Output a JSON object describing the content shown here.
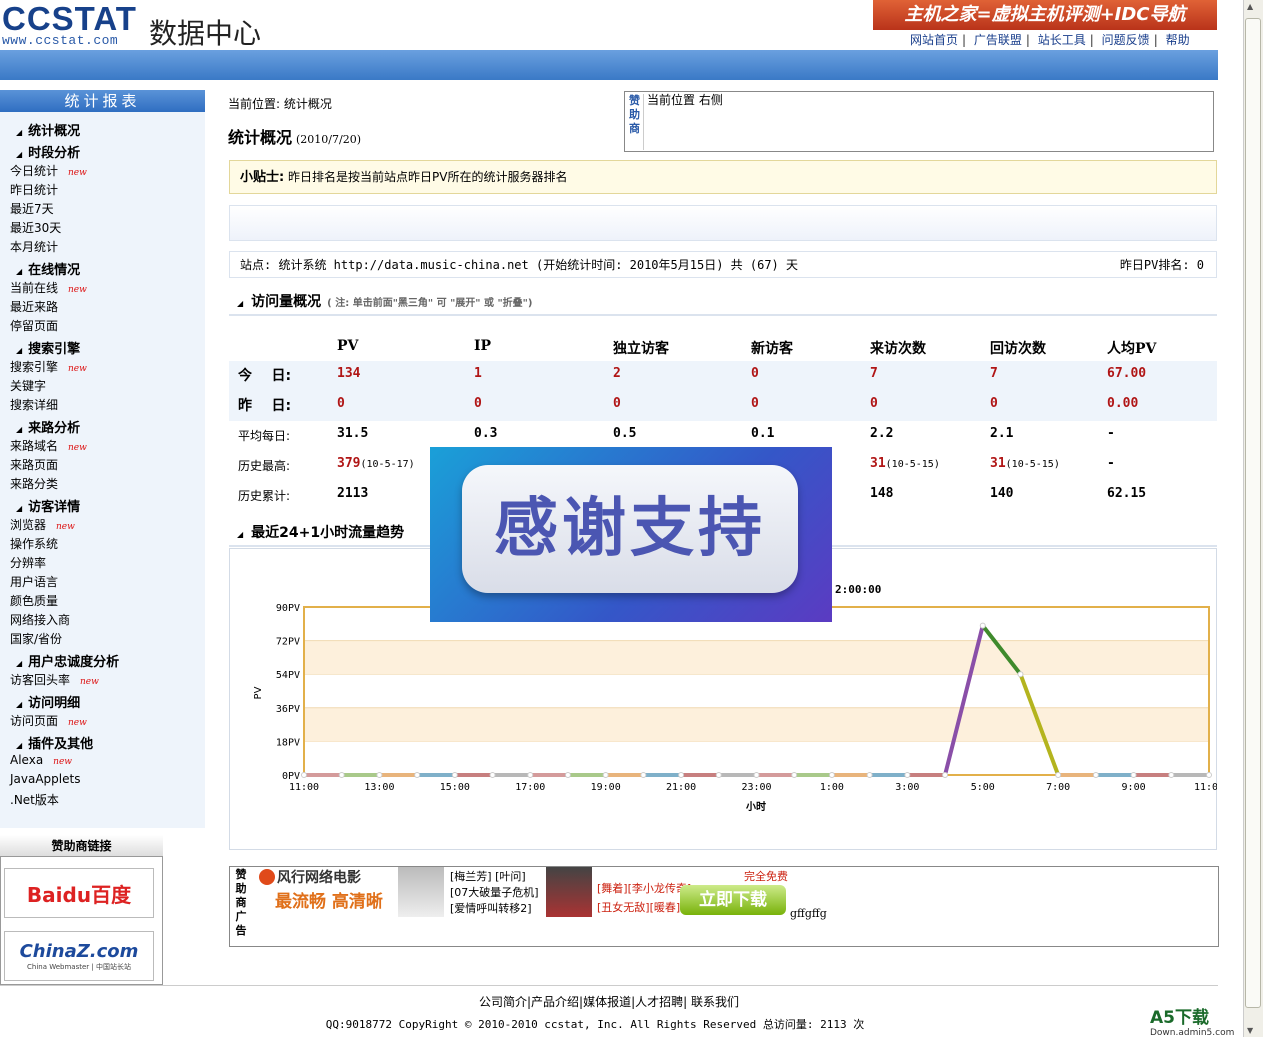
{
  "header": {
    "logo_main": "CCSTAT",
    "logo_url": "www.ccstat.com",
    "subtitle": "数据中心",
    "banner": "主机之家=虚拟主机评测+IDC导航",
    "links": [
      "网站首页",
      "广告联盟",
      "站长工具",
      "问题反馈",
      "帮助"
    ]
  },
  "nav": {
    "title": "统计报表",
    "new_tag": "new",
    "groups": [
      {
        "head": "统计概况",
        "items": []
      },
      {
        "head": "时段分析",
        "items": [
          {
            "label": "今日统计",
            "new": true
          },
          {
            "label": "昨日统计"
          },
          {
            "label": "最近7天"
          },
          {
            "label": "最近30天"
          },
          {
            "label": "本月统计"
          }
        ]
      },
      {
        "head": "在线情况",
        "items": [
          {
            "label": "当前在线",
            "new": true
          },
          {
            "label": "最近来路"
          },
          {
            "label": "停留页面"
          }
        ]
      },
      {
        "head": "搜索引擎",
        "items": [
          {
            "label": "搜索引擎",
            "new": true
          },
          {
            "label": "关键字"
          },
          {
            "label": "搜索详细"
          }
        ]
      },
      {
        "head": "来路分析",
        "items": [
          {
            "label": "来路域名",
            "new": true
          },
          {
            "label": "来路页面"
          },
          {
            "label": "来路分类"
          }
        ]
      },
      {
        "head": "访客详情",
        "items": [
          {
            "label": "浏览器",
            "new": true
          },
          {
            "label": "操作系统"
          },
          {
            "label": "分辨率"
          },
          {
            "label": "用户语言"
          },
          {
            "label": "颜色质量"
          },
          {
            "label": "网络接入商"
          },
          {
            "label": "国家/省份"
          }
        ]
      },
      {
        "head": "用户忠诚度分析",
        "items": [
          {
            "label": "访客回头率",
            "new": true
          }
        ]
      },
      {
        "head": "访问明细",
        "items": [
          {
            "label": "访问页面",
            "new": true
          }
        ]
      },
      {
        "head": "插件及其他",
        "items": [
          {
            "label": "Alexa",
            "new": true
          },
          {
            "label": "JavaApplets"
          },
          {
            "label": ".Net版本"
          }
        ]
      }
    ]
  },
  "sponsor_links": {
    "title": "赞助商链接",
    "logos": [
      "Baidu百度",
      "ChinaZ.com"
    ],
    "chinaz_tagline": "China Webmaster | 中国站长站"
  },
  "main": {
    "breadcrumb": "当前位置: 统计概况",
    "title": "统计概况",
    "date": "(2010/7/20)",
    "ad_tag": "赞助商",
    "ad_text": "当前位置 右侧",
    "tip_label": "小贴士:",
    "tip_text": "昨日排名是按当前站点昨日PV所在的统计服务器排名",
    "site_line": "站点: 统计系统  http://data.music-china.net (开始统计时间: 2010年5月15日) 共 (67) 天",
    "rank": "昨日PV排名: 0"
  },
  "overview": {
    "title": "访问量概况",
    "note": "( 注: 单击前面\"黑三角\" 可 \"展开\" 或 \"折叠\")",
    "columns": [
      "PV",
      "IP",
      "独立访客",
      "新访客",
      "来访次数",
      "回访次数",
      "人均PV"
    ],
    "rows": [
      {
        "label": "今    日:",
        "values": [
          "134",
          "1",
          "2",
          "0",
          "7",
          "7",
          "67.00"
        ]
      },
      {
        "label": "昨    日:",
        "values": [
          "0",
          "0",
          "0",
          "0",
          "0",
          "0",
          "0.00"
        ]
      },
      {
        "label": "平均每日:",
        "values": [
          "31.5",
          "0.3",
          "0.5",
          "0.1",
          "2.2",
          "2.1",
          "-"
        ]
      },
      {
        "label": "历史最高:",
        "values": [
          "379",
          "",
          "",
          "",
          "31",
          "31",
          "-"
        ],
        "dates": [
          "(10-5-17)",
          "",
          "",
          "",
          "(10-5-15)",
          "(10-5-15)",
          ""
        ]
      },
      {
        "label": "历史累计:",
        "values": [
          "2113",
          "",
          "",
          "",
          "148",
          "140",
          "62.15"
        ]
      }
    ]
  },
  "trend": {
    "title": "最近24+1小时流量趋势",
    "tooltip_time": "2:00:00"
  },
  "chart_data": {
    "type": "line",
    "title": "",
    "xlabel": "小时",
    "ylabel": "PV",
    "ylim": [
      0,
      90
    ],
    "yticks": [
      "0PV",
      "18PV",
      "36PV",
      "54PV",
      "72PV",
      "90PV"
    ],
    "xticks": [
      "11:00",
      "13:00",
      "15:00",
      "17:00",
      "19:00",
      "21:00",
      "23:00",
      "1:00",
      "3:00",
      "5:00",
      "7:00",
      "9:00",
      "11:00"
    ],
    "x": [
      "11:00",
      "12:00",
      "13:00",
      "14:00",
      "15:00",
      "16:00",
      "17:00",
      "18:00",
      "19:00",
      "20:00",
      "21:00",
      "22:00",
      "23:00",
      "0:00",
      "1:00",
      "2:00",
      "3:00",
      "4:00",
      "5:00",
      "6:00",
      "7:00",
      "8:00",
      "9:00",
      "10:00",
      "11:00"
    ],
    "values": [
      0,
      0,
      0,
      0,
      0,
      0,
      0,
      0,
      0,
      0,
      0,
      0,
      0,
      0,
      0,
      0,
      0,
      0,
      80,
      54,
      0,
      0,
      0,
      0,
      0
    ],
    "grid": true,
    "colors": {
      "up": "#8a4fa8",
      "down1": "#3f8a2c",
      "down2": "#b4b41e",
      "frame": "#e2b04a",
      "band": "#fdf0dc"
    }
  },
  "overlay": {
    "text": "感谢支持"
  },
  "bottom_ad": {
    "tag": "赞助商广告",
    "movie": "风行网络电影",
    "movie_sub": "最流畅 高清晰",
    "list": [
      "[梅兰芳] [叶问]",
      "[07大破量子危机]",
      "[爱情呼叫转移2]"
    ],
    "list2": [
      "[舞着][李小龙传奇]",
      "[丑女无敌][暖春]"
    ],
    "free": "完全免费",
    "download": "立即下载",
    "extra": "gffgffg"
  },
  "footer": {
    "links": [
      "公司简介",
      "产品介绍",
      "媒体报道",
      "人才招聘",
      "联系我们"
    ],
    "copyright": "QQ:9018772 CopyRight © 2010-2010 ccstat, Inc. All Rights Reserved 总访问量: 2113 次"
  },
  "watermark": {
    "main": "A5下载",
    "sub": "Down.admin5.com"
  }
}
